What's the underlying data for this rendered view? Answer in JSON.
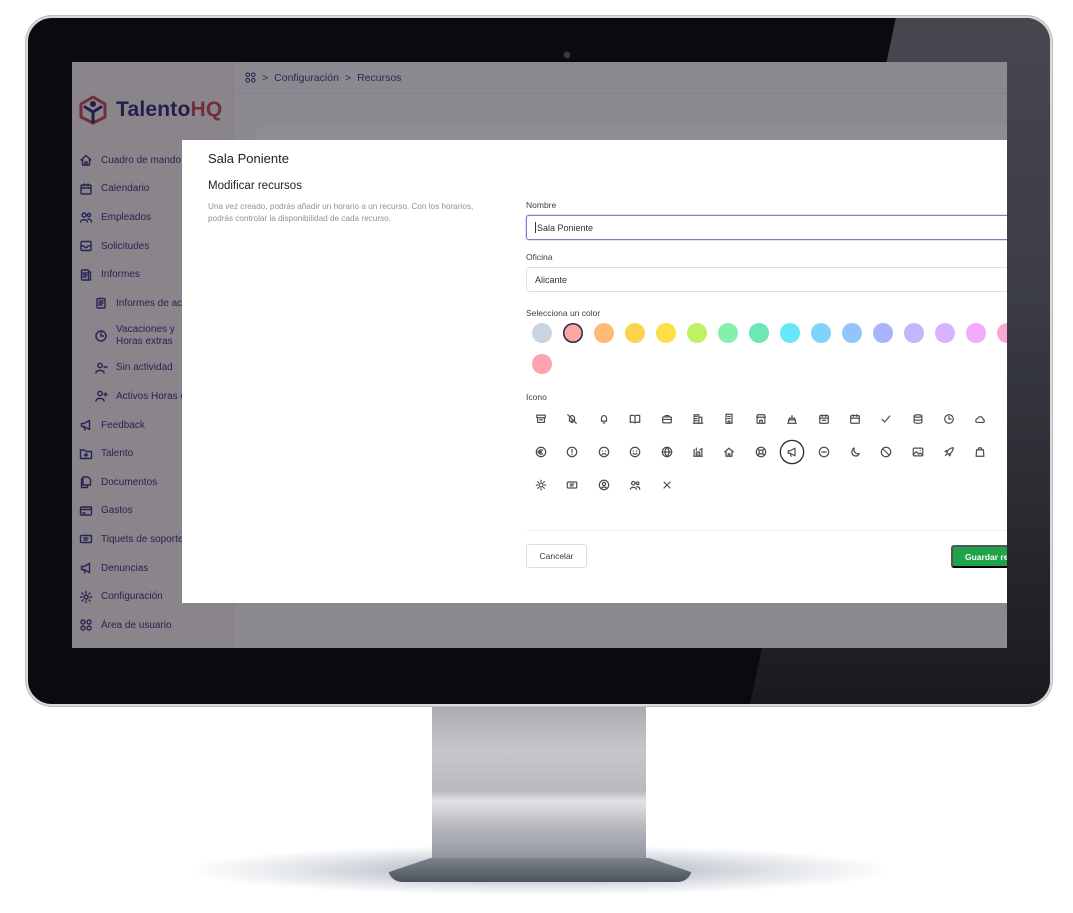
{
  "breadcrumb": {
    "items": [
      "Configuración",
      "Recursos"
    ],
    "separator": ">"
  },
  "brand": {
    "name_part1": "Talento",
    "name_part2": "HQ",
    "color_primary": "#1d1a6e",
    "color_accent": "#c0394f"
  },
  "sidebar": {
    "items": [
      {
        "label": "Cuadro de mando",
        "icon": "home-icon"
      },
      {
        "label": "Calendario",
        "icon": "calendar-icon"
      },
      {
        "label": "Empleados",
        "icon": "users-icon"
      },
      {
        "label": "Solicitudes",
        "icon": "inbox-icon"
      },
      {
        "label": "Informes",
        "icon": "report-icon"
      },
      {
        "label": "Informes de actividad",
        "icon": "clipboard-icon",
        "sub": true
      },
      {
        "label": "Vacaciones y Horas extras",
        "icon": "clock-icon",
        "sub": true
      },
      {
        "label": "Sin actividad",
        "icon": "user-minus-icon",
        "sub": true
      },
      {
        "label": "Activos Horas extras",
        "icon": "user-plus-icon",
        "sub": true
      },
      {
        "label": "Feedback",
        "icon": "megaphone-icon"
      },
      {
        "label": "Talento",
        "icon": "folder-plus-icon"
      },
      {
        "label": "Documentos",
        "icon": "documents-icon"
      },
      {
        "label": "Gastos",
        "icon": "credit-card-icon"
      },
      {
        "label": "Tiquets de soporte",
        "icon": "ticket-icon"
      },
      {
        "label": "Denuncias",
        "icon": "megaphone-icon"
      },
      {
        "label": "Configuración",
        "icon": "gear-icon"
      },
      {
        "label": "Área de usuario",
        "icon": "grid-icon"
      }
    ]
  },
  "modal": {
    "title": "Sala Poniente",
    "section_title": "Modificar recursos",
    "section_desc": "Una vez creado, podrás añadir un horario a un recurso. Con los horarios, podrás controlar la disponibilidad de cada recurso.",
    "name_label": "Nombre",
    "name_value": "Sala Poniente",
    "office_label": "Oficina",
    "office_value": "Alicante",
    "color_label": "Selecciona un color",
    "colors": [
      "#cbd5e1",
      "#fca5a5",
      "#fdba74",
      "#fcd34d",
      "#fde047",
      "#bef264",
      "#86efac",
      "#6ee7b7",
      "#67e8f9",
      "#7dd3fc",
      "#93c5fd",
      "#a5b4fc",
      "#c4b5fd",
      "#d8b4fe",
      "#f0abfc",
      "#f9a8d4",
      "#fda4af"
    ],
    "selected_color": "#fca5a5",
    "icon_label": "Icono",
    "icons": [
      "archive-icon",
      "bell-slash-icon",
      "bell-icon",
      "book-open-icon",
      "briefcase-icon",
      "building-office-icon",
      "building-icon",
      "storefront-icon",
      "cake-icon",
      "calendar-days-icon",
      "calendar-icon",
      "check-icon",
      "database-icon",
      "clock-icon",
      "cloud-icon",
      "more-icon",
      "euro-icon",
      "exclamation-circle-icon",
      "face-frown-icon",
      "face-smile-icon",
      "globe-icon",
      "building-library-icon",
      "home-icon",
      "lifebuoy-icon",
      "megaphone-icon",
      "minus-circle-icon",
      "moon-icon",
      "no-symbol-icon",
      "photo-icon",
      "rocket-icon",
      "shopping-bag-icon",
      "more-icon",
      "sun-icon",
      "ticket-icon",
      "user-circle-icon",
      "users-icon",
      "x-mark-icon"
    ],
    "selected_icon": "megaphone-icon",
    "cancel_label": "Cancelar",
    "save_label": "Guardar recurso"
  }
}
